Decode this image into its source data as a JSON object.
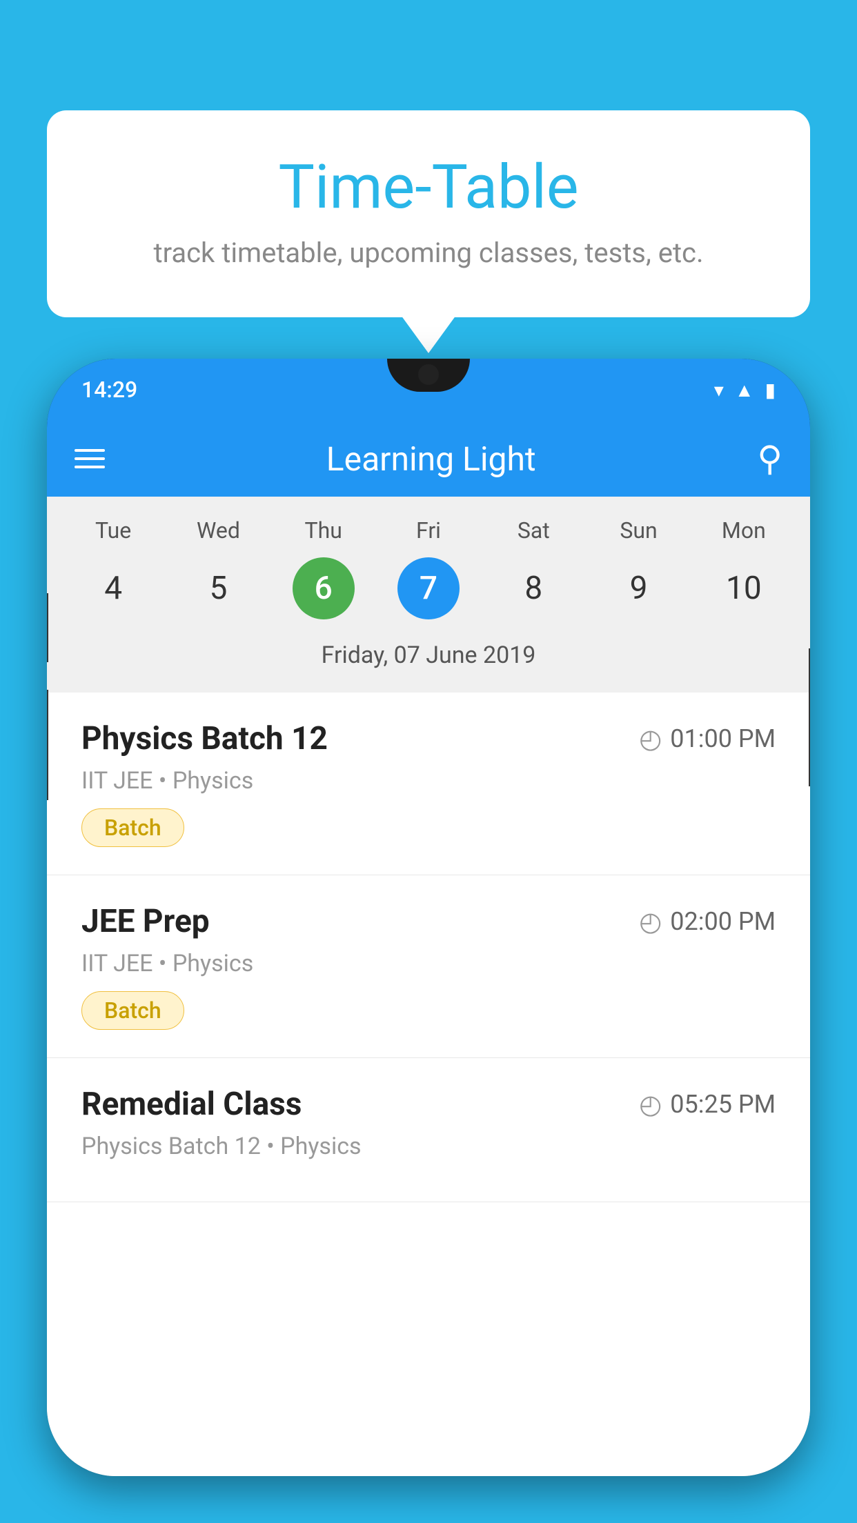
{
  "background_color": "#29b6e8",
  "tooltip": {
    "title": "Time-Table",
    "subtitle": "track timetable, upcoming classes, tests, etc."
  },
  "phone": {
    "status_bar": {
      "time": "14:29"
    },
    "toolbar": {
      "title": "Learning Light"
    },
    "calendar": {
      "days": [
        {
          "label": "Tue",
          "num": "4"
        },
        {
          "label": "Wed",
          "num": "5"
        },
        {
          "label": "Thu",
          "num": "6",
          "state": "today"
        },
        {
          "label": "Fri",
          "num": "7",
          "state": "selected"
        },
        {
          "label": "Sat",
          "num": "8"
        },
        {
          "label": "Sun",
          "num": "9"
        },
        {
          "label": "Mon",
          "num": "10"
        }
      ],
      "selected_date_label": "Friday, 07 June 2019"
    },
    "classes": [
      {
        "name": "Physics Batch 12",
        "time": "01:00 PM",
        "meta": "IIT JEE • Physics",
        "badge": "Batch"
      },
      {
        "name": "JEE Prep",
        "time": "02:00 PM",
        "meta": "IIT JEE • Physics",
        "badge": "Batch"
      },
      {
        "name": "Remedial Class",
        "time": "05:25 PM",
        "meta": "Physics Batch 12 • Physics",
        "badge": null
      }
    ]
  }
}
